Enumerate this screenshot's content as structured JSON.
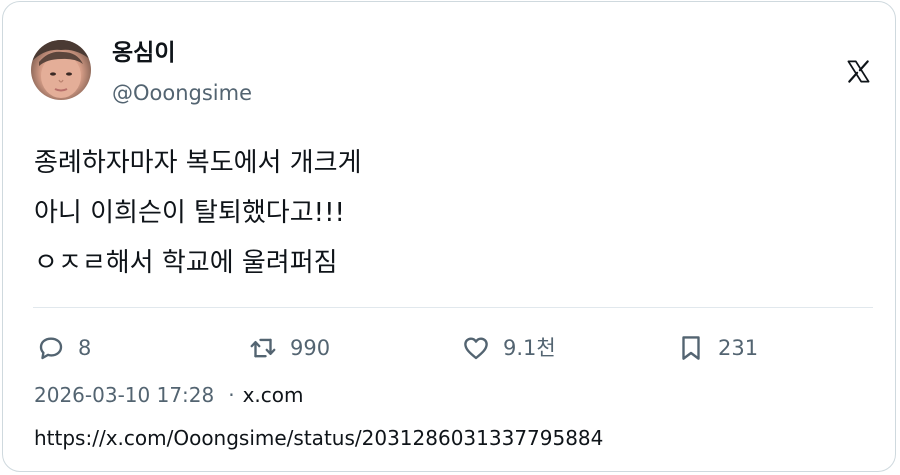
{
  "author": {
    "display_name": "옹심이",
    "handle": "@Ooongsime",
    "avatar": "avatar-photo"
  },
  "brand": {
    "logo_icon": "x-logo-icon"
  },
  "tweet": {
    "lines": [
      "종례하자마자 복도에서 개크게",
      "아니 이희슨이 탈퇴했다고!!!",
      "ㅇㅈㄹ해서 학교에 울려퍼짐"
    ]
  },
  "actions": {
    "reply": {
      "icon": "reply-icon",
      "count": "8"
    },
    "retweet": {
      "icon": "retweet-icon",
      "count": "990"
    },
    "like": {
      "icon": "heart-icon",
      "count": "9.1천"
    },
    "bookmark": {
      "icon": "bookmark-icon",
      "count": "231"
    }
  },
  "meta": {
    "timestamp": "2026-03-10 17:28",
    "separator": "·",
    "domain": "x.com"
  },
  "url": "https://x.com/Ooongsime/status/2031286031337795884",
  "colors": {
    "text_primary": "#0f1419",
    "text_secondary": "#536471",
    "border": "#cfd9de"
  }
}
